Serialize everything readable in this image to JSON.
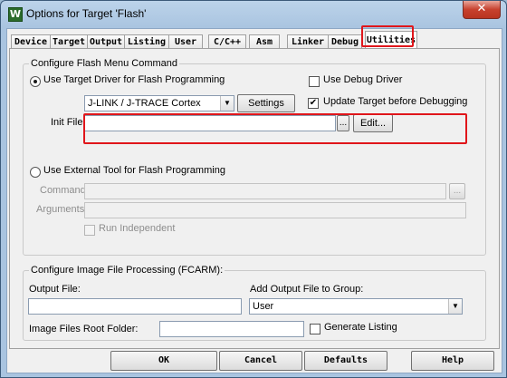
{
  "window": {
    "title": "Options for Target 'Flash'",
    "close_glyph": "✕",
    "icon_glyph": "W"
  },
  "tabs": [
    {
      "label": "Device"
    },
    {
      "label": "Target"
    },
    {
      "label": "Output"
    },
    {
      "label": "Listing"
    },
    {
      "label": "User"
    },
    {
      "label": "C/C++"
    },
    {
      "label": "Asm"
    },
    {
      "label": "Linker"
    },
    {
      "label": "Debug"
    },
    {
      "label": "Utilities",
      "active": true
    }
  ],
  "flash_menu": {
    "legend": "Configure Flash Menu Command",
    "use_target_driver_label": "Use Target Driver for Flash Programming",
    "use_debug_driver_label": "Use Debug Driver",
    "driver_select_value": "J-LINK / J-TRACE Cortex",
    "settings_label": "Settings",
    "update_target_label": "Update Target before Debugging",
    "update_target_checked": "✔",
    "init_file_label": "Init File:",
    "init_file_value": "",
    "browse_label": "...",
    "edit_label": "Edit...",
    "use_external_tool_label": "Use External Tool for Flash Programming",
    "command_label": "Command:",
    "command_browse_label": "...",
    "arguments_label": "Arguments:",
    "run_independent_label": "Run Independent"
  },
  "image_processing": {
    "legend": "Configure Image File Processing (FCARM):",
    "output_file_label": "Output File:",
    "output_file_value": "",
    "add_output_group_label": "Add Output File  to Group:",
    "group_select_value": "User",
    "root_folder_label": "Image Files Root Folder:",
    "root_folder_value": "",
    "generate_listing_label": "Generate Listing"
  },
  "footer": {
    "ok": "OK",
    "cancel": "Cancel",
    "defaults": "Defaults",
    "help": "Help"
  },
  "colors": {
    "highlight": "#e0161b",
    "title_bar": "#a9c4e0",
    "close_button": "#c7412e"
  }
}
